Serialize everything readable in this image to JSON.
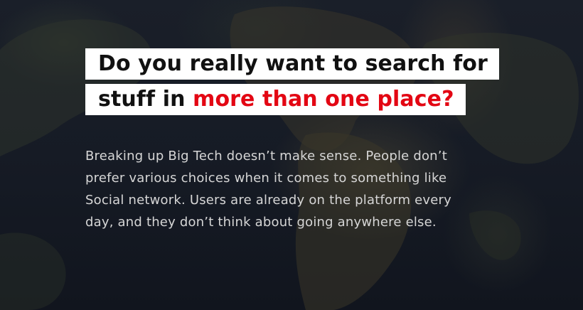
{
  "heading": {
    "line1": "Do you really want to search for",
    "line2_prefix": "stuff in ",
    "line2_highlight": "more than one place?"
  },
  "paragraph": {
    "line1": "Breaking up Big Tech doesn’t make sense. People don’t",
    "line2": "prefer various choices when it comes to something like",
    "line3": "Social network. Users are already on the platform every",
    "line4": "day, and they don’t think about going anywhere else."
  },
  "colors": {
    "highlight": "#e30613",
    "heading_bg": "#ffffff",
    "body_text": "#d6d6d6"
  }
}
